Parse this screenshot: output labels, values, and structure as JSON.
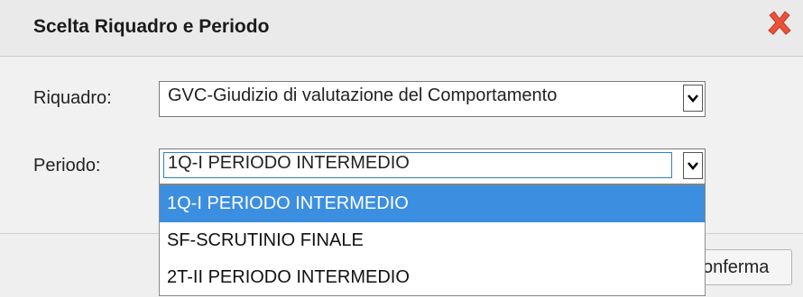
{
  "dialog": {
    "title": "Scelta Riquadro e Periodo",
    "close_icon": "close-x-icon",
    "close_color": "#e8533a"
  },
  "form": {
    "riquadro_label": "Riquadro:",
    "riquadro_value": "GVC-Giudizio di valutazione del Comportamento",
    "periodo_label": "Periodo:",
    "periodo_value": "1Q-I PERIODO INTERMEDIO"
  },
  "dropdown": {
    "options": [
      "1Q-I PERIODO INTERMEDIO",
      "SF-SCRUTINIO FINALE",
      "2T-II PERIODO INTERMEDIO"
    ],
    "selected_index": 0,
    "highlight_color": "#3c8fe0"
  },
  "footer": {
    "confirm_label": "onferma"
  }
}
